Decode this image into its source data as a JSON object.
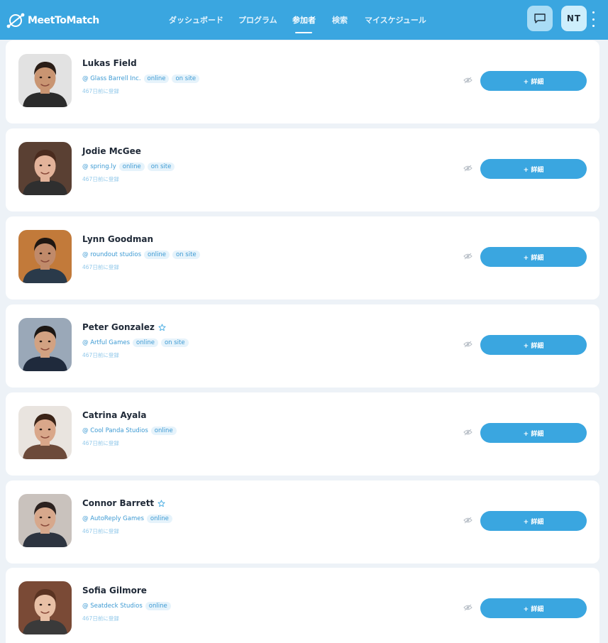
{
  "app": {
    "brand": "MeetToMatch",
    "brand_color": "#3aa6e0"
  },
  "nav": {
    "tabs": [
      {
        "label": "ダッシュボード",
        "active": false
      },
      {
        "label": "プログラム",
        "active": false
      },
      {
        "label": "参加者",
        "active": true
      },
      {
        "label": "検索",
        "active": false
      },
      {
        "label": "マイスケジュール",
        "active": false
      }
    ]
  },
  "header": {
    "chat_icon": "chat-icon",
    "user_initials": "NT",
    "more_icon": "kebab-menu-icon"
  },
  "participants": [
    {
      "name": "Lukas Field",
      "company": "@ Glass Barrell Inc.",
      "badges": [
        "online",
        "on site"
      ],
      "joined": "467日前に登録",
      "starred": false,
      "skin": "#c99572",
      "hair": "#2a1e18",
      "bg": "#e2e2e2",
      "shirt": "#2b2b2b",
      "button": "+ 詳細"
    },
    {
      "name": "Jodie McGee",
      "company": "@ spring.ly",
      "badges": [
        "online",
        "on site"
      ],
      "joined": "467日前に登録",
      "starred": false,
      "skin": "#e3b39a",
      "hair": "#4a2b1e",
      "bg": "#5a4033",
      "shirt": "#2f2f2f",
      "button": "+ 詳細"
    },
    {
      "name": "Lynn Goodman",
      "company": "@ roundout studios",
      "badges": [
        "online",
        "on site"
      ],
      "joined": "467日前に登録",
      "starred": false,
      "skin": "#c08a6a",
      "hair": "#1f1712",
      "bg": "#c27a3a",
      "shirt": "#2a3a4a",
      "button": "+ 詳細"
    },
    {
      "name": "Peter Gonzalez",
      "company": "@ Artful Games",
      "badges": [
        "online",
        "on site"
      ],
      "joined": "467日前に登録",
      "starred": true,
      "skin": "#d2a282",
      "hair": "#1c1714",
      "bg": "#9aa8b8",
      "shirt": "#1f2a3c",
      "button": "+ 詳細"
    },
    {
      "name": "Catrina Ayala",
      "company": "@ Cool Panda Studios",
      "badges": [
        "online"
      ],
      "joined": "467日前に登録",
      "starred": false,
      "skin": "#d9a78a",
      "hair": "#3b2418",
      "bg": "#e9e4df",
      "shirt": "#6c4a3a",
      "button": "+ 詳細"
    },
    {
      "name": "Connor Barrett",
      "company": "@ AutoReply Games",
      "badges": [
        "online"
      ],
      "joined": "467日前に登録",
      "starred": true,
      "skin": "#d7a88c",
      "hair": "#2b2220",
      "bg": "#c9c2bd",
      "shirt": "#2d3440",
      "button": "+ 詳細"
    },
    {
      "name": "Sofia Gilmore",
      "company": "@ Seatdeck Studios",
      "badges": [
        "online"
      ],
      "joined": "467日前に登録",
      "starred": false,
      "skin": "#e8c0a6",
      "hair": "#5a3322",
      "bg": "#7a4a36",
      "shirt": "#3a3a3a",
      "button": "+ 詳細"
    }
  ]
}
